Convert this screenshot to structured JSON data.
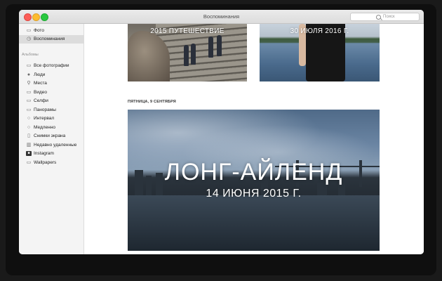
{
  "window": {
    "title": "Воспоминания"
  },
  "search": {
    "placeholder": "Поиск"
  },
  "sidebar": {
    "top_items": [
      {
        "label": "Фото",
        "icon": "photos-icon"
      },
      {
        "label": "Воспоминания",
        "icon": "memories-icon",
        "selected": true
      }
    ],
    "albums_header": "Альбомы",
    "albums": [
      {
        "label": "Все фотографии",
        "icon": "all-photos-icon"
      },
      {
        "label": "Люди",
        "icon": "people-icon"
      },
      {
        "label": "Места",
        "icon": "places-icon"
      },
      {
        "label": "Видео",
        "icon": "videos-icon"
      },
      {
        "label": "Селфи",
        "icon": "selfies-icon"
      },
      {
        "label": "Панорамы",
        "icon": "panoramas-icon"
      },
      {
        "label": "Интервал",
        "icon": "timelapse-icon"
      },
      {
        "label": "Медленно",
        "icon": "slomo-icon"
      },
      {
        "label": "Снимки экрана",
        "icon": "screenshots-icon"
      },
      {
        "label": "Недавно удаленные",
        "icon": "trash-icon"
      },
      {
        "label": "Instagram",
        "icon": "instagram-icon"
      },
      {
        "label": "Wallpapers",
        "icon": "folder-icon"
      }
    ]
  },
  "memories": {
    "top_left": {
      "subtitle": "2015 ПУТЕШЕСТВИЕ"
    },
    "top_right": {
      "subtitle": "30 ИЮЛЯ 2016 Г."
    },
    "section_header": "ПЯТНИЦА, 9 СЕНТЯБРЯ",
    "featured": {
      "title": "ЛОНГ-АЙЛЕНД",
      "subtitle": "14 ИЮНЯ 2015 Г."
    }
  },
  "colors": {
    "close": "#fc5d57",
    "minimize": "#fdbc2e",
    "maximize": "#28c83f",
    "sidebar_bg": "#f4f4f4",
    "selection": "#dcdcdc"
  }
}
